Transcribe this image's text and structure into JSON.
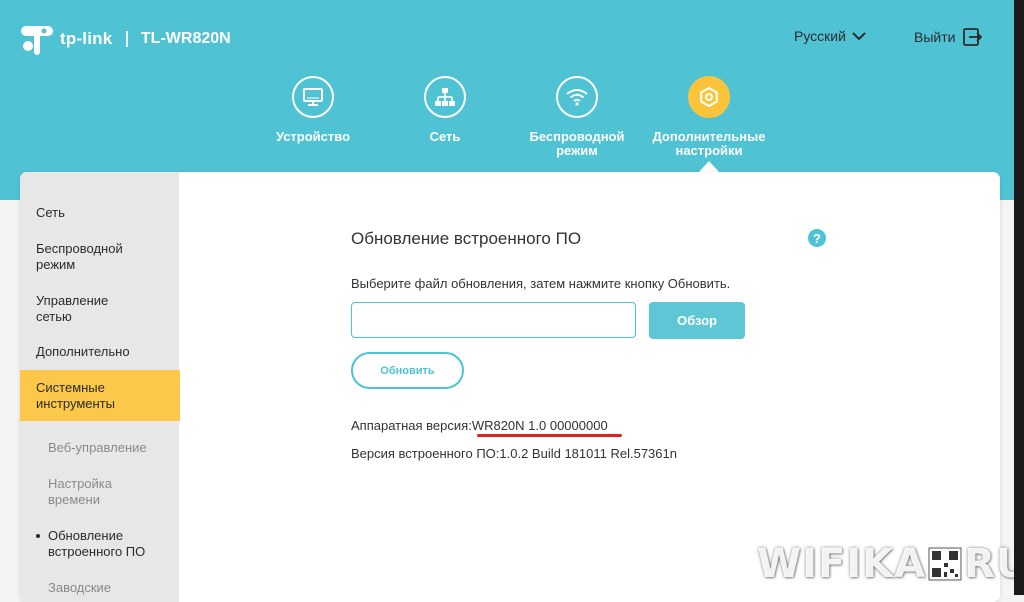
{
  "header": {
    "brand": "tp-link",
    "model": "TL-WR820N",
    "language": "Русский",
    "logout": "Выйти",
    "colors": {
      "header_bg": "#4fc3d4",
      "accent_yellow": "#fbc43a"
    }
  },
  "nav_tabs": [
    {
      "label": "Устройство",
      "icon": "monitor-icon"
    },
    {
      "label": "Сеть",
      "icon": "network-icon"
    },
    {
      "label": "Беспроводной режим",
      "icon": "wifi-icon"
    },
    {
      "label": "Дополнительные настройки",
      "icon": "gear-icon",
      "active": true
    }
  ],
  "sidebar": {
    "items": [
      {
        "label": "Сеть"
      },
      {
        "label": "Беспроводной режим"
      },
      {
        "label": "Управление сетью"
      },
      {
        "label": "Дополнительно"
      },
      {
        "label": "Системные инструменты",
        "active": true
      }
    ],
    "subitems": [
      {
        "label": "Веб-управление"
      },
      {
        "label": "Настройка времени"
      },
      {
        "label": "Обновление встроенного ПО",
        "current": true
      },
      {
        "label": "Заводские"
      }
    ]
  },
  "main": {
    "title": "Обновление встроенного ПО",
    "instruction": "Выберите файл обновления, затем нажмите кнопку Обновить.",
    "file_input_value": "",
    "browse_label": "Обзор",
    "update_label": "Обновить",
    "hardware_label": "Аппаратная версия:",
    "hardware_value": "WR820N 1.0 00000000",
    "firmware_label": "Версия встроенного ПО:",
    "firmware_value": "1.0.2 Build 181011 Rel.57361n",
    "help_glyph": "?"
  },
  "watermark": {
    "left": "WIFIKA",
    "right": "RU"
  }
}
